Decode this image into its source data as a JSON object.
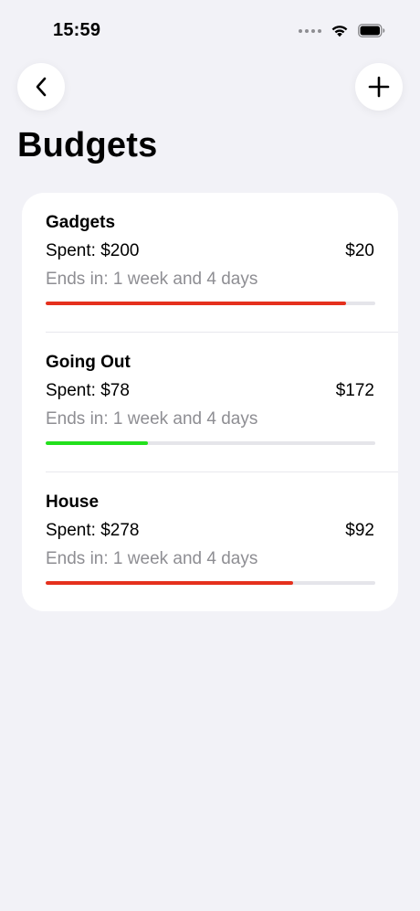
{
  "status_bar": {
    "time": "15:59"
  },
  "nav": {
    "back_icon": "chevron-left-icon",
    "add_icon": "plus-icon"
  },
  "page": {
    "title": "Budgets"
  },
  "colors": {
    "over_limit": "#E5301D",
    "on_track": "#22E01C"
  },
  "budgets": [
    {
      "name": "Gadgets",
      "spent": "Spent: $200",
      "remaining": "$20",
      "ends": "Ends in: 1 week and 4 days",
      "progress": 0.91,
      "bar_color": "#E5301D"
    },
    {
      "name": "Going Out",
      "spent": "Spent: $78",
      "remaining": "$172",
      "ends": "Ends in: 1 week and 4 days",
      "progress": 0.31,
      "bar_color": "#22E01C"
    },
    {
      "name": "House",
      "spent": "Spent: $278",
      "remaining": "$92",
      "ends": "Ends in: 1 week and 4 days",
      "progress": 0.75,
      "bar_color": "#E5301D"
    }
  ]
}
